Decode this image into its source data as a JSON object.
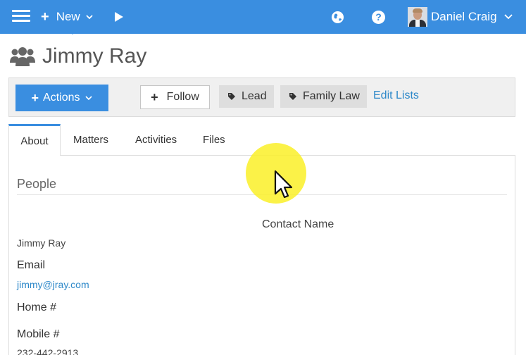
{
  "topbar": {
    "new_label": "New",
    "user_name": "Daniel Craig",
    "help_glyph": "?",
    "icons": [
      "menu-icon",
      "plus-icon",
      "chevron-down-icon",
      "play-icon",
      "globe-icon",
      "help-icon",
      "avatar"
    ]
  },
  "header": {
    "title": "Jimmy Ray",
    "icon": "people-icon"
  },
  "toolbar": {
    "actions_label": "Actions",
    "follow_label": "Follow",
    "tags": [
      "Lead",
      "Family Law"
    ],
    "edit_lists_label": "Edit Lists"
  },
  "tabs": [
    {
      "label": "About",
      "active": true
    },
    {
      "label": "Matters",
      "active": false
    },
    {
      "label": "Activities",
      "active": false
    },
    {
      "label": "Files",
      "active": false
    }
  ],
  "panel": {
    "section_title": "People",
    "column_header": "Contact Name",
    "contact_name": "Jimmy Ray",
    "email_label": "Email",
    "email_value": "jimmy@jray.com",
    "home_label": "Home #",
    "mobile_label": "Mobile #",
    "mobile_value": "232-442-2913"
  },
  "colors": {
    "topbar": "#3a8ee0",
    "accent": "#3a8ee0",
    "link": "#2d88c9",
    "toolbar_bg": "#f0f0f0",
    "tag_bg": "#dedede",
    "cursor_highlight": "#faf028"
  }
}
